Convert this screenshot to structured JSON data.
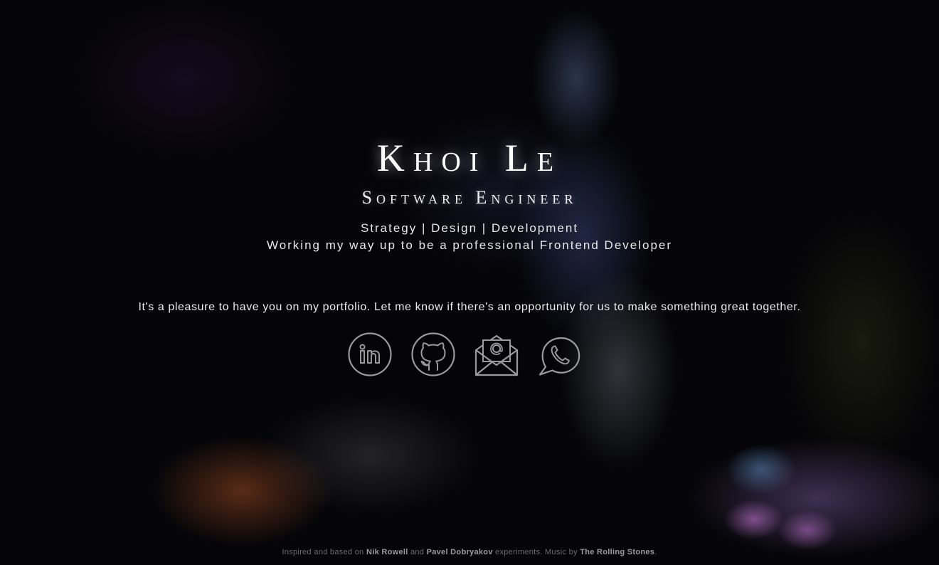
{
  "hero": {
    "name": "Khoi Le",
    "title": "Software Engineer",
    "tags": "Strategy | Design | Development",
    "tagline": "Working my way up to be a professional Frontend Developer",
    "intro": "It's a pleasure to have you on my portfolio. Let me know if there's an opportunity for us to make something great together."
  },
  "socials": [
    {
      "icon": "linkedin-icon"
    },
    {
      "icon": "github-icon"
    },
    {
      "icon": "email-icon"
    },
    {
      "icon": "whatsapp-icon"
    }
  ],
  "footer": {
    "prefix": "Inspired and based on",
    "author1": "Nik Rowell",
    "and": "and",
    "author2": "Pavel Dobryakov",
    "middle": "experiments. Music by",
    "music": "The Rolling Stones",
    "suffix": "."
  },
  "colors": {
    "background": "#050508",
    "text": "#ffffff",
    "icon_stroke": "#9a9a9a"
  }
}
